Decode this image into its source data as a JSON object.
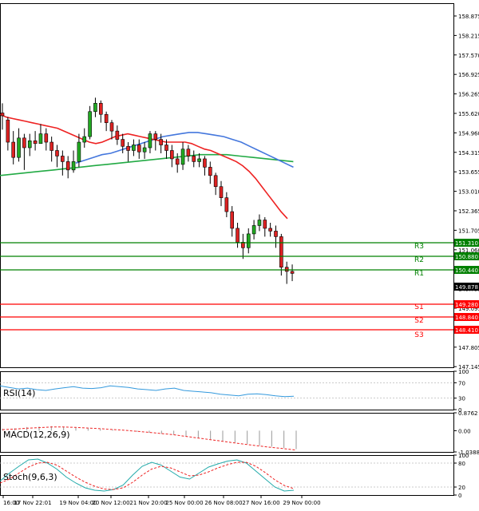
{
  "chart_data": {
    "type": "candlestick",
    "main": {
      "ylim": [
        146.5,
        159.6
      ],
      "price_ticks": [
        "158.875",
        "158.215",
        "157.570",
        "156.925",
        "156.265",
        "155.620",
        "154.960",
        "154.315",
        "153.655",
        "153.010",
        "152.365",
        "151.705",
        "151.060",
        "150.400",
        "149.755",
        "149.095",
        "148.450",
        "147.805",
        "147.145"
      ],
      "current_price": "149.878",
      "levels": [
        {
          "name": "R3",
          "value": "151.310",
          "price": 151.31,
          "color": "#008000"
        },
        {
          "name": "R2",
          "value": "150.880",
          "price": 150.88,
          "color": "#008000"
        },
        {
          "name": "R1",
          "value": "150.440",
          "price": 150.44,
          "color": "#008000"
        },
        {
          "name": "S1",
          "value": "149.280",
          "price": 149.28,
          "color": "#ff0000"
        },
        {
          "name": "S2",
          "value": "148.840",
          "price": 148.84,
          "color": "#ff0000"
        },
        {
          "name": "S3",
          "value": "148.410",
          "price": 148.41,
          "color": "#ff0000"
        }
      ],
      "candles": [
        [
          155.65,
          155.55,
          156.0,
          155.05
        ],
        [
          155.4,
          154.6,
          155.5,
          154.3
        ],
        [
          154.6,
          154.05,
          155.0,
          153.8
        ],
        [
          154.05,
          154.75,
          155.1,
          153.9
        ],
        [
          154.75,
          154.4,
          154.9,
          153.6
        ],
        [
          154.4,
          154.65,
          154.9,
          154.1
        ],
        [
          154.65,
          154.55,
          155.0,
          154.3
        ],
        [
          154.55,
          154.9,
          155.25,
          154.6
        ],
        [
          154.9,
          154.6,
          155.1,
          154.3
        ],
        [
          154.6,
          154.3,
          154.8,
          153.9
        ],
        [
          154.3,
          154.1,
          154.5,
          153.7
        ],
        [
          154.1,
          153.9,
          154.3,
          153.4
        ],
        [
          153.9,
          153.6,
          154.1,
          153.3
        ],
        [
          153.6,
          153.9,
          154.3,
          153.5
        ],
        [
          153.9,
          154.6,
          154.9,
          153.7
        ],
        [
          154.6,
          154.8,
          155.1,
          154.4
        ],
        [
          154.8,
          155.7,
          155.9,
          154.7
        ],
        [
          155.7,
          156.0,
          156.2,
          155.5
        ],
        [
          156.0,
          155.6,
          156.1,
          155.3
        ],
        [
          155.6,
          155.3,
          155.7,
          155.0
        ],
        [
          155.3,
          155.0,
          155.4,
          154.7
        ],
        [
          155.0,
          154.7,
          155.2,
          154.5
        ],
        [
          154.7,
          154.45,
          154.9,
          154.2
        ],
        [
          154.45,
          154.3,
          154.6,
          153.9
        ],
        [
          154.3,
          154.5,
          154.7,
          154.1
        ],
        [
          154.5,
          154.25,
          154.7,
          154.0
        ],
        [
          154.25,
          154.4,
          154.6,
          154.0
        ],
        [
          154.4,
          154.9,
          155.0,
          154.2
        ],
        [
          154.9,
          154.7,
          155.0,
          154.3
        ],
        [
          154.7,
          154.5,
          154.9,
          154.2
        ],
        [
          154.5,
          154.3,
          154.7,
          154.0
        ],
        [
          154.3,
          154.0,
          154.5,
          153.7
        ],
        [
          154.0,
          153.8,
          154.2,
          153.5
        ],
        [
          153.8,
          154.35,
          154.6,
          153.6
        ],
        [
          154.35,
          154.1,
          154.5,
          153.9
        ],
        [
          154.1,
          153.9,
          154.3,
          153.7
        ],
        [
          153.9,
          154.0,
          154.2,
          153.7
        ],
        [
          154.0,
          153.7,
          154.1,
          153.4
        ],
        [
          153.7,
          153.4,
          153.9,
          153.1
        ],
        [
          153.4,
          153.0,
          153.5,
          152.7
        ],
        [
          153.0,
          152.6,
          153.2,
          152.3
        ],
        [
          152.6,
          152.1,
          152.8,
          151.9
        ],
        [
          152.1,
          151.5,
          152.3,
          151.2
        ],
        [
          151.5,
          151.0,
          151.7,
          150.8
        ],
        [
          151.0,
          150.8,
          151.3,
          150.4
        ],
        [
          150.8,
          151.3,
          151.5,
          150.6
        ],
        [
          151.3,
          151.6,
          151.8,
          151.1
        ],
        [
          151.6,
          151.8,
          152.0,
          151.4
        ],
        [
          151.8,
          151.5,
          151.9,
          151.2
        ],
        [
          151.5,
          151.4,
          151.7,
          151.2
        ],
        [
          151.4,
          151.2,
          151.6,
          150.8
        ],
        [
          151.2,
          150.1,
          151.3,
          149.8
        ],
        [
          150.1,
          149.95,
          150.3,
          149.5
        ],
        [
          149.95,
          149.878,
          150.2,
          149.6
        ]
      ],
      "ma_red": [
        155.6,
        155.5,
        155.45,
        155.4,
        155.35,
        155.3,
        155.25,
        155.2,
        155.15,
        155.1,
        155.0,
        154.9,
        154.8,
        154.7,
        154.6,
        154.55,
        154.6,
        154.7,
        154.8,
        154.85,
        154.9,
        154.85,
        154.8,
        154.75,
        154.7,
        154.65,
        154.6,
        154.6,
        154.6,
        154.6,
        154.55,
        154.45,
        154.35,
        154.3,
        154.2,
        154.1,
        154.0,
        153.9,
        153.75,
        153.55,
        153.3,
        153.0,
        152.7,
        152.4,
        152.1,
        151.85
      ],
      "ma_blue": [
        153.85,
        153.95,
        154.05,
        154.15,
        154.2,
        154.3,
        154.4,
        154.5,
        154.6,
        154.7,
        154.8,
        154.85,
        154.9,
        154.95,
        154.95,
        154.9,
        154.85,
        154.8,
        154.7,
        154.6,
        154.45,
        154.3,
        154.15,
        154.0,
        153.85,
        153.7
      ],
      "ma_green": [
        153.4,
        153.45,
        153.5,
        153.55,
        153.6,
        153.65,
        153.7,
        153.75,
        153.8,
        153.85,
        153.9,
        153.95,
        154.0,
        154.05,
        154.1,
        154.15,
        154.15,
        154.15,
        154.1,
        154.05,
        154.0,
        153.95,
        153.9
      ]
    },
    "x_labels": [
      "16:00",
      "17 Nov 22:01",
      "19 Nov 04:00",
      "20 Nov 12:00",
      "21 Nov 20:00",
      "25 Nov 00:00",
      "26 Nov 08:00",
      "27 Nov 16:00",
      "29 Nov 00:00"
    ],
    "rsi": {
      "label": "RSI(14)",
      "ticks": [
        "100",
        "70",
        "30",
        "0"
      ],
      "values": [
        62,
        58,
        54,
        56,
        52,
        50,
        54,
        57,
        60,
        56,
        55,
        57,
        62,
        60,
        58,
        54,
        52,
        50,
        54,
        56,
        50,
        48,
        46,
        44,
        40,
        38,
        36,
        40,
        41,
        39,
        36,
        34,
        35
      ]
    },
    "macd": {
      "label": "MACD(12,26,9)",
      "ticks": [
        "0.8762",
        "0.00",
        "-1.0388"
      ],
      "hist": [
        0.1,
        0.12,
        0.18,
        0.2,
        0.22,
        0.18,
        0.15,
        0.12,
        0.08,
        0.05,
        0.0,
        -0.05,
        -0.1,
        -0.15,
        -0.2,
        -0.28,
        -0.35,
        -0.42,
        -0.5,
        -0.58,
        -0.65,
        -0.72,
        -0.78,
        -0.85,
        -0.9
      ],
      "signal": [
        0.05,
        0.08,
        0.12,
        0.15,
        0.18,
        0.18,
        0.16,
        0.13,
        0.1,
        0.06,
        0.02,
        -0.03,
        -0.08,
        -0.14,
        -0.2,
        -0.28,
        -0.36,
        -0.44,
        -0.52,
        -0.6,
        -0.68,
        -0.75,
        -0.82,
        -0.88,
        -0.95
      ]
    },
    "stoch": {
      "label": "Stoch(9,6,3)",
      "ticks": [
        "100",
        "80",
        "20",
        "0"
      ],
      "k": [
        35,
        55,
        72,
        88,
        90,
        80,
        65,
        45,
        30,
        18,
        12,
        10,
        14,
        25,
        50,
        72,
        82,
        75,
        60,
        45,
        40,
        55,
        70,
        78,
        85,
        88,
        80,
        60,
        40,
        20,
        10,
        12
      ],
      "d": [
        30,
        40,
        55,
        70,
        80,
        82,
        75,
        60,
        45,
        32,
        22,
        15,
        14,
        18,
        32,
        50,
        65,
        72,
        68,
        58,
        48,
        50,
        58,
        68,
        76,
        82,
        82,
        72,
        56,
        38,
        24,
        16
      ]
    }
  }
}
